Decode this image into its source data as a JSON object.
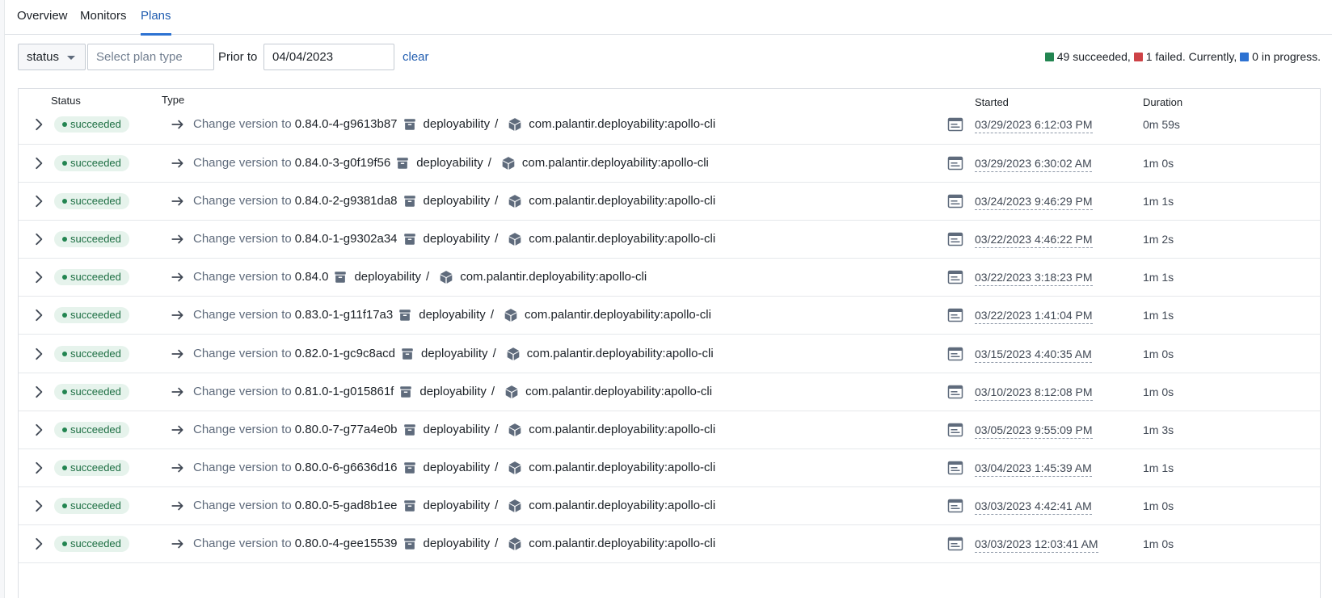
{
  "tabs": [
    {
      "label": "Overview",
      "active": false
    },
    {
      "label": "Monitors",
      "active": false
    },
    {
      "label": "Plans",
      "active": true
    }
  ],
  "filters": {
    "status_label": "status",
    "plan_type_placeholder": "Select plan type",
    "prior_to_label": "Prior to",
    "prior_to_value": "04/04/2023",
    "clear_label": "clear"
  },
  "summary": {
    "succeeded_text": "49 succeeded,",
    "failed_text": "1 failed. Currently,",
    "in_progress_text": "0 in progress.",
    "colors": {
      "succeeded": "#238551",
      "failed": "#cd4246",
      "in_progress": "#2d72d2"
    }
  },
  "table": {
    "headers": {
      "status": "Status",
      "type": "Type",
      "started": "Started",
      "duration": "Duration"
    },
    "change_prefix": "Change version to",
    "product_group": "deployability",
    "artifact": "com.palantir.deployability:apollo-cli",
    "rows": [
      {
        "status": "succeeded",
        "version": "0.84.0-4-g9613b87",
        "started": "03/29/2023 6:12:03 PM",
        "duration": "0m 59s"
      },
      {
        "status": "succeeded",
        "version": "0.84.0-3-g0f19f56",
        "started": "03/29/2023 6:30:02 AM",
        "duration": "1m 0s"
      },
      {
        "status": "succeeded",
        "version": "0.84.0-2-g9381da8",
        "started": "03/24/2023 9:46:29 PM",
        "duration": "1m 1s"
      },
      {
        "status": "succeeded",
        "version": "0.84.0-1-g9302a34",
        "started": "03/22/2023 4:46:22 PM",
        "duration": "1m 2s"
      },
      {
        "status": "succeeded",
        "version": "0.84.0",
        "started": "03/22/2023 3:18:23 PM",
        "duration": "1m 1s"
      },
      {
        "status": "succeeded",
        "version": "0.83.0-1-g11f17a3",
        "started": "03/22/2023 1:41:04 PM",
        "duration": "1m 1s"
      },
      {
        "status": "succeeded",
        "version": "0.82.0-1-gc9c8acd",
        "started": "03/15/2023 4:40:35 AM",
        "duration": "1m 0s"
      },
      {
        "status": "succeeded",
        "version": "0.81.0-1-g015861f",
        "started": "03/10/2023 8:12:08 PM",
        "duration": "1m 0s"
      },
      {
        "status": "succeeded",
        "version": "0.80.0-7-g77a4e0b",
        "started": "03/05/2023 9:55:09 PM",
        "duration": "1m 3s"
      },
      {
        "status": "succeeded",
        "version": "0.80.0-6-g6636d16",
        "started": "03/04/2023 1:45:39 AM",
        "duration": "1m 1s"
      },
      {
        "status": "succeeded",
        "version": "0.80.0-5-gad8b1ee",
        "started": "03/03/2023 4:42:41 AM",
        "duration": "1m 0s"
      },
      {
        "status": "succeeded",
        "version": "0.80.0-4-gee15539",
        "started": "03/03/2023 12:03:41 AM",
        "duration": "1m 0s"
      }
    ]
  },
  "icons": {
    "expand": "chevron-right-icon",
    "change": "arrow-right-icon",
    "product_group": "box-icon",
    "artifact": "cube-icon",
    "details": "document-icon"
  }
}
